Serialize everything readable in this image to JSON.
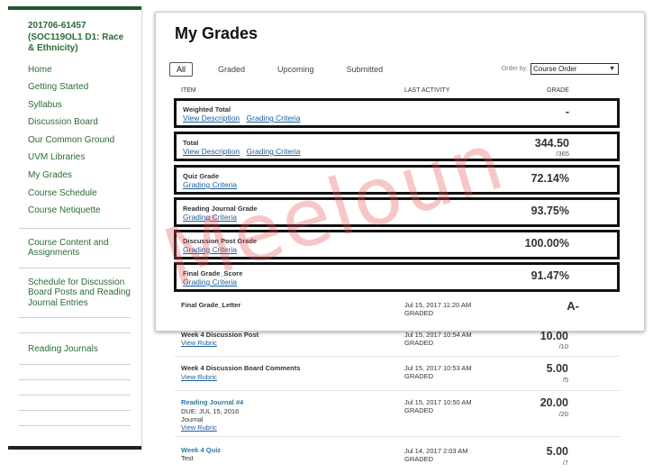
{
  "sidebar": {
    "course_title": "201706-61457 (SOC119OL1 D1: Race & Ethnicity)",
    "items": [
      {
        "label": "Home"
      },
      {
        "label": "Getting Started"
      },
      {
        "label": "Syllabus"
      },
      {
        "label": "Discussion Board"
      },
      {
        "label": "Our Common Ground"
      },
      {
        "label": "UVM Libraries"
      },
      {
        "label": "My Grades"
      },
      {
        "label": "Course Schedule"
      },
      {
        "label": "Course Netiquette"
      }
    ],
    "blocks": [
      {
        "label": "Course Content and Assignments"
      },
      {
        "label": "Schedule for Discussion Board Posts and Reading Journal Entries"
      },
      {
        "label": "Reading Journals"
      }
    ]
  },
  "grades": {
    "title": "My Grades",
    "filters": [
      "All",
      "Graded",
      "Upcoming",
      "Submitted"
    ],
    "order_label": "Order by:",
    "order_value": "Course Order",
    "headers": {
      "item": "ITEM",
      "last_activity": "LAST ACTIVITY",
      "grade": "GRADE"
    },
    "links": {
      "view_description": "View Description",
      "grading_criteria": "Grading Criteria",
      "view_rubric": "View Rubric"
    },
    "rows": [
      {
        "name": "Weighted Total",
        "grade": "-",
        "sub": ""
      },
      {
        "name": "Total",
        "grade": "344.50",
        "sub": "/365"
      },
      {
        "name": "Quiz Grade",
        "grade": "72.14%",
        "sub": ""
      },
      {
        "name": "Reading Journal Grade",
        "grade": "93.75%",
        "sub": ""
      },
      {
        "name": "Discussion Post Grade",
        "grade": "100.00%",
        "sub": ""
      },
      {
        "name": "Final Grade_Score",
        "grade": "91.47%",
        "sub": ""
      }
    ],
    "letter": {
      "name": "Final Grade_Letter",
      "date": "Jul 15, 2017 11:20 AM",
      "status": "GRADED",
      "grade": "A-"
    }
  },
  "background_rows": [
    {
      "name": "Week 4 Discussion Post",
      "date": "Jul 15, 2017 10:54 AM",
      "status": "GRADED",
      "grade": "10.00",
      "out": "/10"
    },
    {
      "name": "Week 4 Discussion Board Comments",
      "date": "Jul 15, 2017 10:53 AM",
      "status": "GRADED",
      "grade": "5.00",
      "out": "/5"
    },
    {
      "name": "Reading Journal #4",
      "due": "DUE: JUL 15, 2016",
      "type": "Journal",
      "date": "Jul 15, 2017 10:50 AM",
      "status": "GRADED",
      "grade": "20.00",
      "out": "/20"
    },
    {
      "name": "Week 4 Quiz",
      "type": "Test",
      "date": "Jul 14, 2017 2:03 AM",
      "status": "GRADED",
      "grade": "5.00",
      "out": "/7"
    }
  ],
  "watermark": "Meeloun"
}
